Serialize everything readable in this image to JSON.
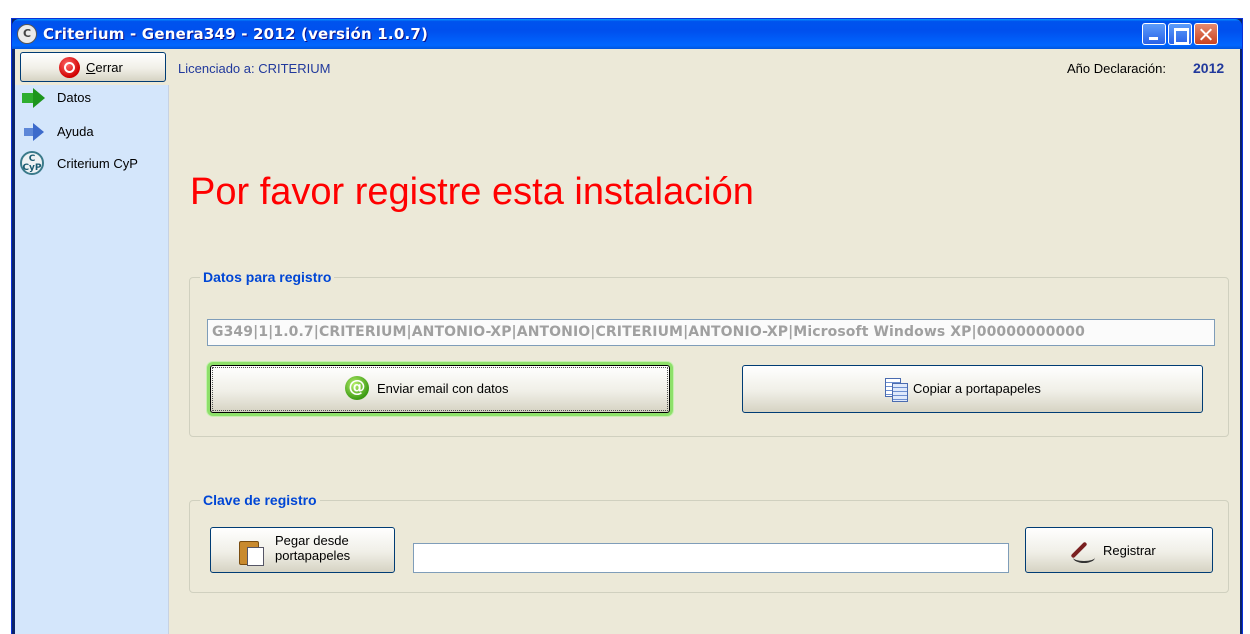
{
  "window": {
    "title": "Criterium - Genera349 - 2012 (versión 1.0.7)",
    "icon": "criterium-logo-icon"
  },
  "toolbar": {
    "close_label_prefix": "",
    "close_label_accel": "C",
    "close_label_rest": "errar",
    "licensed_to": "Licenciado a: CRITERIUM",
    "year_label": "Año Declaración:",
    "year_value": "2012"
  },
  "sidebar": {
    "items": [
      {
        "label": "Datos",
        "icon": "green-arrow-icon"
      },
      {
        "label": "Ayuda",
        "icon": "blue-arrow-icon"
      },
      {
        "label": "Criterium CyP",
        "icon": "criterium-cyp-icon"
      }
    ]
  },
  "main": {
    "headline": "Por favor registre esta instalación",
    "registration_data": {
      "title": "Datos para registro",
      "value": "G349|1|1.0.7|CRITERIUM|ANTONIO-XP|ANTONIO|CRITERIUM|ANTONIO-XP|Microsoft Windows XP|00000000000",
      "email_button": "Enviar email con datos",
      "copy_button": "Copiar a portapapeles"
    },
    "registration_key": {
      "title": "Clave de registro",
      "paste_button_line1": "Pegar desde",
      "paste_button_line2": "portapapeles",
      "key_value": "",
      "register_button": "Registrar"
    }
  },
  "colors": {
    "headline": "#ff0000",
    "group_title": "#0046d5",
    "sidebar_bg": "#d4e6fb",
    "client_bg": "#ece9d8"
  }
}
